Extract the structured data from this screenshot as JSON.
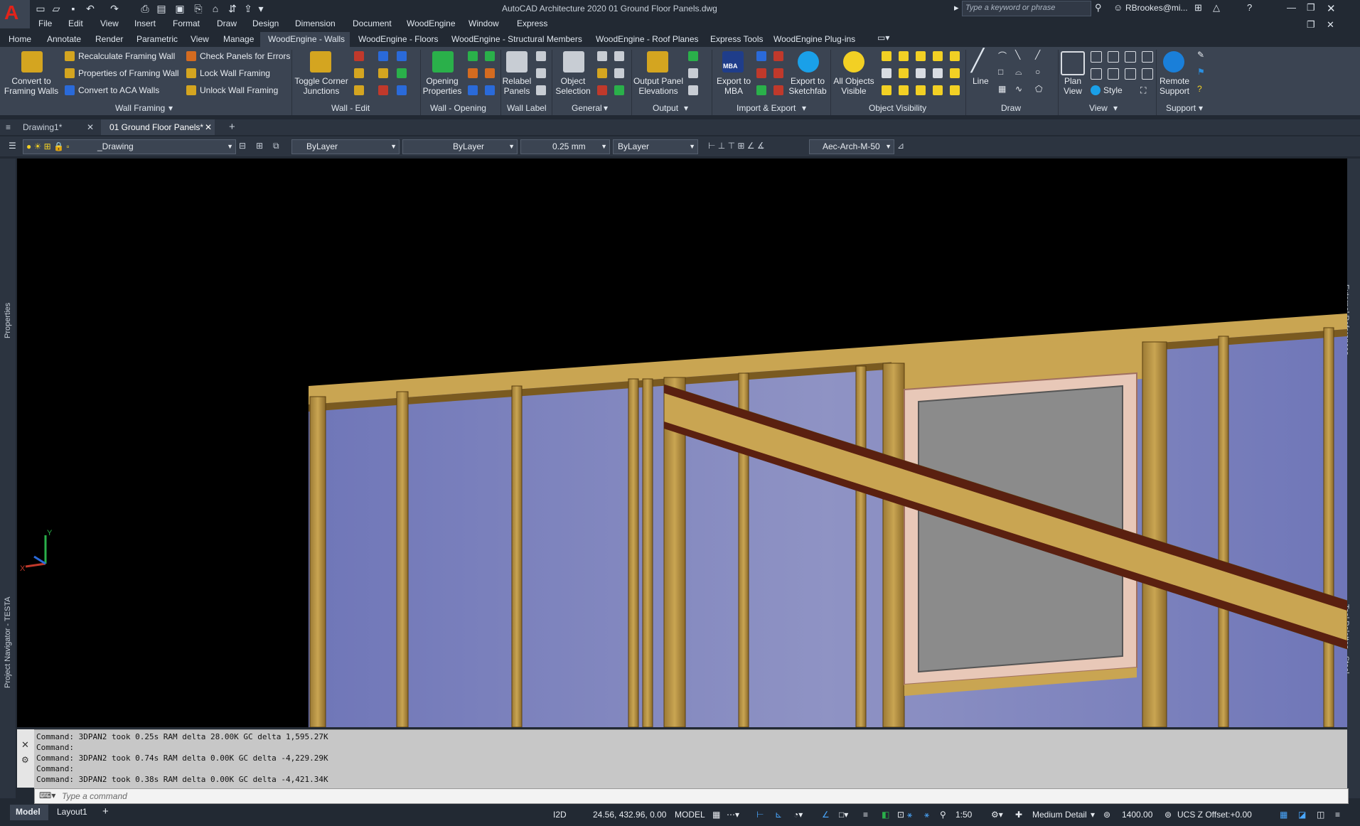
{
  "app": {
    "title": "AutoCAD Architecture 2020   01 Ground Floor Panels.dwg",
    "logo_letter": "A"
  },
  "search": {
    "placeholder": "Type a keyword or phrase"
  },
  "user": {
    "name": "RBrookes@mi..."
  },
  "menu": [
    "File",
    "Edit",
    "View",
    "Insert",
    "Format",
    "Draw",
    "Design",
    "Dimension",
    "Document",
    "WoodEngine",
    "Window",
    "Express"
  ],
  "ribbon_tabs": [
    "Home",
    "Annotate",
    "Render",
    "Parametric",
    "View",
    "Manage",
    "WoodEngine - Walls",
    "WoodEngine - Floors",
    "WoodEngine - Structural Members",
    "WoodEngine - Roof Planes",
    "Express Tools",
    "WoodEngine Plug-ins"
  ],
  "ribbon": {
    "convert_framing": "Convert to\nFraming Walls",
    "recalc": "Recalculate Framing Wall",
    "props_framing": "Properties of Framing Wall",
    "convert_aca": "Convert to ACA Walls",
    "check_panels": "Check Panels for Errors",
    "lock_framing": "Lock Wall Framing",
    "unlock_framing": "Unlock Wall Framing",
    "toggle_corner": "Toggle Corner\nJunctions",
    "opening_props": "Opening\nProperties",
    "relabel": "Relabel\nPanels",
    "object_selection": "Object\nSelection",
    "output_panel": "Output Panel\nElevations",
    "export_mba": "Export to\nMBA",
    "export_sketchfab": "Export to\nSketchfab",
    "all_visible": "All Objects\nVisible",
    "line": "Line",
    "plan_view": "Plan\nView",
    "style": "Style",
    "remote_support": "Remote\nSupport",
    "mba_logo": "MBA",
    "panels": [
      "Wall Framing",
      "Wall - Edit",
      "Wall - Opening",
      "Wall Label",
      "General",
      "Output",
      "Import & Export",
      "Object Visibility",
      "Draw",
      "View",
      "Support"
    ]
  },
  "doc_tabs": [
    "Drawing1*",
    "01 Ground Floor Panels*"
  ],
  "props": {
    "layer": "_Drawing",
    "color": "ByLayer",
    "linetype": "ByLayer",
    "lineweight": "0.25 mm",
    "plotstyle": "ByLayer",
    "dimstyle": "Aec-Arch-M-50"
  },
  "side_labels": {
    "left_top": "Properties",
    "left_bottom": "Project Navigator - TESTA",
    "right_top": "External References",
    "right_bottom": "Tool Palettes - Steel"
  },
  "ucs": {
    "y": "Y",
    "x": "X"
  },
  "command_history": [
    "Command: 3DPAN2 took 0.25s RAM delta 28.00K GC delta 1,595.27K",
    "Command:",
    "Command: 3DPAN2 took 0.74s RAM delta 0.00K GC delta -4,229.29K",
    "Command:",
    "Command: 3DPAN2 took 0.38s RAM delta 0.00K GC delta -4,421.34K"
  ],
  "command": {
    "placeholder": "Type a command"
  },
  "layout_tabs": [
    "Model",
    "Layout1"
  ],
  "status": {
    "mode_2d": "I2D",
    "coords": "24.56, 432.96, 0.00",
    "space": "MODEL",
    "scale": "1:50",
    "detail": "Medium Detail",
    "elevation": "1400.00",
    "ucs_offset": "UCS Z Offset:+0.00"
  },
  "colors": {
    "accent_blue": "#0696d7",
    "ribbon_bg": "#3b4452",
    "dark_bg": "#222933"
  }
}
